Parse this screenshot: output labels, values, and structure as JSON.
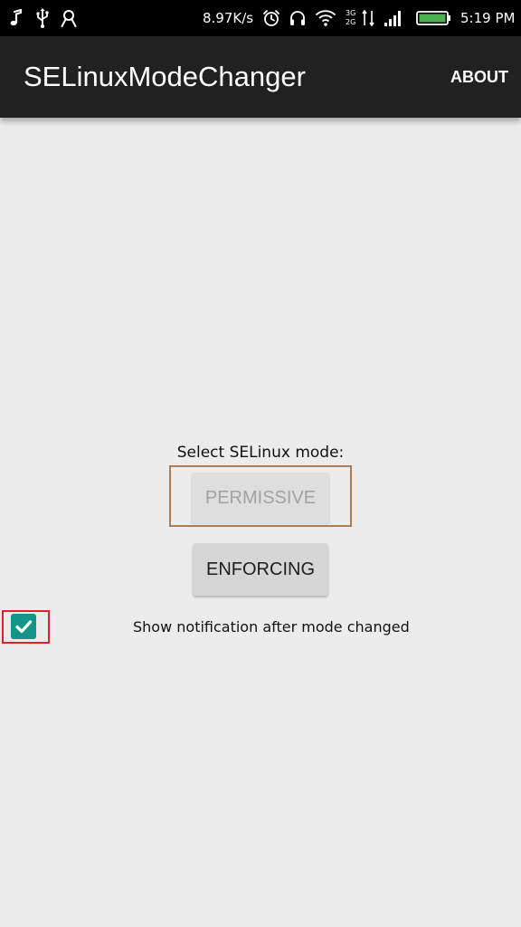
{
  "status_bar": {
    "net_speed": "8.97K/s",
    "net_type_top": "3G",
    "net_type_bottom": "2G",
    "time": "5:19 PM",
    "icons": [
      "music-note-icon",
      "usb-icon",
      "account-icon",
      "alarm-icon",
      "headset-icon",
      "wifi-icon",
      "signal-icon",
      "battery-icon"
    ],
    "battery_color": "#4caf50"
  },
  "app_bar": {
    "title": "SELinuxModeChanger",
    "about_label": "ABOUT"
  },
  "content": {
    "mode_label": "Select SELinux mode:",
    "permissive_label": "PERMISSIVE",
    "permissive_enabled": false,
    "enforcing_label": "ENFORCING",
    "notification_label": "Show notification after mode changed",
    "notification_checked": true
  },
  "colors": {
    "status_bar_bg": "#000000",
    "app_bar_bg": "#212121",
    "page_bg": "#ececec",
    "checkbox_accent": "#139687",
    "permissive_highlight": "#b07a55",
    "checkbox_highlight": "#e0202a"
  }
}
